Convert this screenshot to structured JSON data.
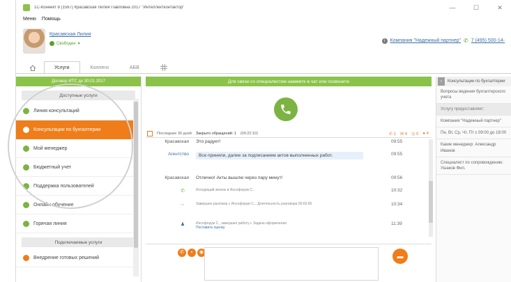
{
  "window": {
    "title": "1С-Коннект 8 (1567) Красавская Лилия Павловна 2017 \"Интеллектконтактор\"",
    "controls": {
      "minimize": "—",
      "maximize": "☐",
      "close": "✕"
    }
  },
  "menu": [
    "Меню",
    "Помощь"
  ],
  "user": {
    "name": "Красавская Лилия",
    "status": "Свободен"
  },
  "company": {
    "name": "Компания \"Надежный партнер\"",
    "phone": "7 (495) 500-14-"
  },
  "tabs": [
    {
      "label": "",
      "icon": "home-icon"
    },
    {
      "label": "Услуги"
    },
    {
      "label": "Коллеги"
    },
    {
      "label": "АБВ"
    },
    {
      "label": ""
    }
  ],
  "left": {
    "its_banner": "Договор ИТС до 30.01.2017",
    "available_header": "Доступные услуги",
    "services": [
      "Линия консультаций",
      "Консультации по бухгалтерии",
      "Мой менеджер",
      "Бюджетный учет",
      "Поддержка пользователей",
      "Онлайн обучение",
      "Горячая линия"
    ],
    "connect_header": "Подключаемые услуги",
    "connect_services": [
      "Внедрение готовых решений"
    ]
  },
  "center": {
    "banner": "Для связи со специалистом нажмите в чат или позвоните",
    "chat_header": {
      "date": "Последние 30 дней",
      "history": "Закрыто обращений: 1",
      "time": "(09:22:10)",
      "counters": [
        "1",
        "4",
        "0",
        "4"
      ]
    },
    "messages": [
      {
        "who": "Красавская",
        "text": "Это радует!",
        "time": "09:55",
        "kind": "user"
      },
      {
        "who": "Агентство",
        "text": "Все приняли, далее за подписанием актов выполненных работ.",
        "time": "09:55",
        "kind": "agent"
      },
      {
        "who": "Красавская",
        "text": "Отлично! Акты вышлю через пару минут!",
        "time": "09:56",
        "kind": "user"
      },
      {
        "who": "",
        "text": "Исходящий звонок в Инсофорум С...",
        "time": "10:32",
        "kind": "event-phone"
      },
      {
        "who": "",
        "text": "Завершен разговор с Инсофорум С... Длительность разговора 00:03:00",
        "time": "10:34",
        "kind": "event-arrow"
      },
      {
        "who": "",
        "text": "Инсофорум С., завершил работу с Задача оформления",
        "link": "Поставить оценку",
        "time": "11:39",
        "kind": "event-person"
      }
    ]
  },
  "right": {
    "header": "Консультации по бухгалтерии",
    "blocks": [
      "Вопросы ведения бухгалтерского учета",
      "Услугу предоставляет:",
      "Компания \"Надежный партнер\"",
      "Пн, Вт, Ср, Чт, Пт c 09:00 до 18:00",
      "Какие менеджер: Александр Иванов",
      "Специалист по сопровождению: Ушаков Фил."
    ]
  },
  "colors": {
    "green": "#8bc34a",
    "orange": "#ef7d1a",
    "link": "#3b6fa8"
  }
}
